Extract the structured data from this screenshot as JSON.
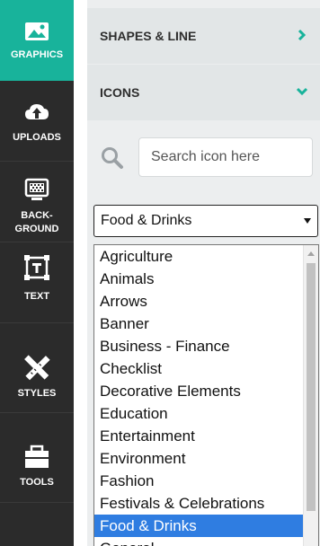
{
  "toolbar": {
    "items": [
      {
        "label": "GRAPHICS",
        "icon": "image-icon"
      },
      {
        "label": "UPLOADS",
        "icon": "cloud-upload-icon"
      },
      {
        "label": "BACK-\nGROUND",
        "icon": "monitor-icon"
      },
      {
        "label": "TEXT",
        "icon": "text-frame-icon"
      },
      {
        "label": "STYLES",
        "icon": "ruler-pencil-icon"
      },
      {
        "label": "TOOLS",
        "icon": "toolbox-icon"
      }
    ],
    "active_color": "#18b39b",
    "background": "#2b2b2b"
  },
  "panel": {
    "shapes_section": {
      "title": "SHAPES & LINE",
      "state": "collapsed"
    },
    "icons_section": {
      "title": "ICONS",
      "state": "expanded"
    },
    "search": {
      "placeholder": "Search icon here",
      "value": ""
    },
    "category_select": {
      "selected": "Food & Drinks",
      "options": [
        "Agriculture",
        "Animals",
        "Arrows",
        "Banner",
        "Business - Finance",
        "Checklist",
        "Decorative Elements",
        "Education",
        "Entertainment",
        "Environment",
        "Fashion",
        "Festivals & Celebrations",
        "Food & Drinks",
        "General"
      ],
      "highlight_color": "#2f7de1"
    },
    "accent_color": "#18b39b"
  }
}
